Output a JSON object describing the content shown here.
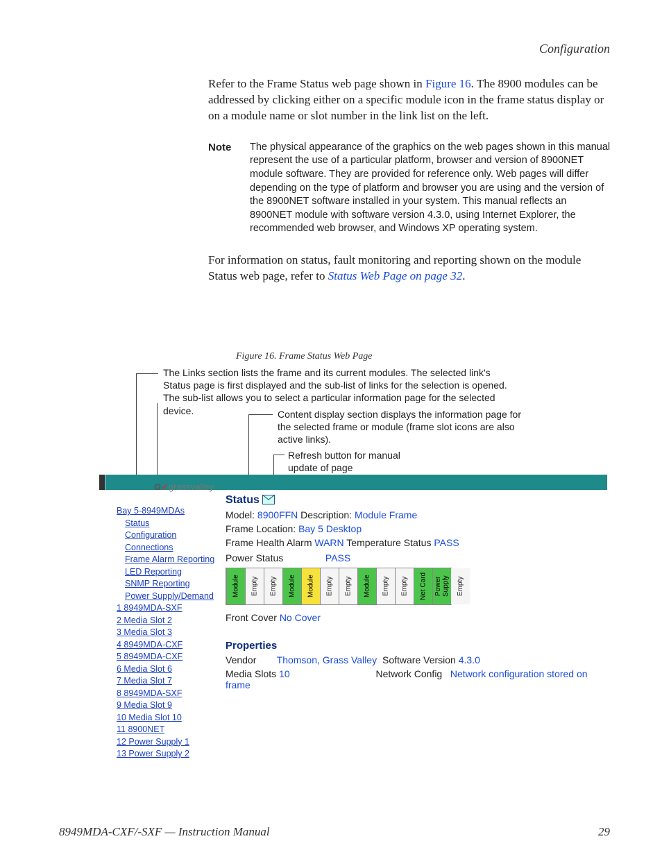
{
  "header": {
    "section": "Configuration"
  },
  "body": {
    "para1a": "Refer to the Frame Status web page shown in ",
    "para1link": "Figure 16",
    "para1b": ". The 8900 modules can be addressed by clicking either on a specific module icon in the frame status display or on a module name or slot number in the link list on the left.",
    "note_label": "Note",
    "note_text": "The physical appearance of the graphics on the web pages shown in this manual represent the use of a particular platform, browser and version of 8900NET module software. They are provided for reference only. Web pages will differ depending on the type of platform and browser you are using and the version of the 8900NET software installed in your system. This manual reflects an 8900NET module with software version 4.3.0, using Internet Explorer, the recommended web browser, and Windows XP operating system.",
    "para2a": "For information on status, fault monitoring and reporting shown on the module Status web page, refer to ",
    "para2link": "Status Web Page on page 32",
    "para2b": "."
  },
  "figure": {
    "caption": "Figure 16.  Frame Status Web Page"
  },
  "annotations": {
    "links_section": "The Links section lists the frame and its current modules. The selected link's Status page is first displayed and the sub-list of links for the selection is opened. The sub-list allows you to select a particular information page for the selected device.",
    "content_section": "Content display section displays the information page for the selected frame or module (frame slot icons are also active links).",
    "refresh": "Refresh button for manual update of page"
  },
  "logo": {
    "g": "G",
    "check": "✓",
    "rest": "grassvalley"
  },
  "sidebar": {
    "top": "Bay 5-8949MDAs",
    "sub": [
      "Status",
      "Configuration",
      "Connections",
      "Frame Alarm Reporting",
      "LED Reporting",
      "SNMP Reporting",
      "Power Supply/Demand"
    ],
    "slots": [
      "1 8949MDA-SXF",
      "2 Media Slot 2",
      "3 Media Slot 3",
      "4 8949MDA-CXF",
      "5 8949MDA-CXF",
      "6 Media Slot 6",
      "7 Media Slot 7",
      "8 8949MDA-SXF",
      "9 Media Slot 9",
      "10 Media Slot 10",
      "11 8900NET",
      "12 Power Supply 1",
      "13 Power Supply 2"
    ]
  },
  "status": {
    "heading": "Status",
    "model_key": "Model:",
    "model_val": "8900FFN",
    "desc_key": "Description:",
    "desc_val": "Module Frame",
    "loc_key": "Frame Location:",
    "loc_val": "Bay 5 Desktop",
    "fha_key": "Frame Health Alarm",
    "fha_val": "WARN",
    "temp_key": "Temperature Status",
    "temp_val": "PASS",
    "ps_key": "Power Status",
    "ps_val": "PASS",
    "slots": [
      {
        "label": "Module",
        "cls": "green"
      },
      {
        "label": "Empty",
        "cls": "empty"
      },
      {
        "label": "Empty",
        "cls": "empty"
      },
      {
        "label": "Module",
        "cls": "green"
      },
      {
        "label": "Module",
        "cls": "yellow"
      },
      {
        "label": "Empty",
        "cls": "empty"
      },
      {
        "label": "Empty",
        "cls": "empty"
      },
      {
        "label": "Module",
        "cls": "green"
      },
      {
        "label": "Empty",
        "cls": "empty"
      },
      {
        "label": "Empty",
        "cls": "empty"
      },
      {
        "label": "Net Card",
        "cls": "green"
      },
      {
        "label": "Power Supply",
        "cls": "green"
      },
      {
        "label": "Empty",
        "cls": "empty"
      }
    ],
    "front_key": "Front Cover",
    "front_val": "No Cover",
    "properties_h": "Properties",
    "vendor_key": "Vendor",
    "vendor_val": "Thomson, Grass Valley",
    "sw_key": "Software Version",
    "sw_val": "4.3.0",
    "media_key": "Media Slots",
    "media_val": "10",
    "net_key": "Network Config",
    "net_val": "Network configuration stored on frame"
  },
  "footer": {
    "left": "8949MDA-CXF/-SXF — Instruction Manual",
    "right": "29"
  }
}
